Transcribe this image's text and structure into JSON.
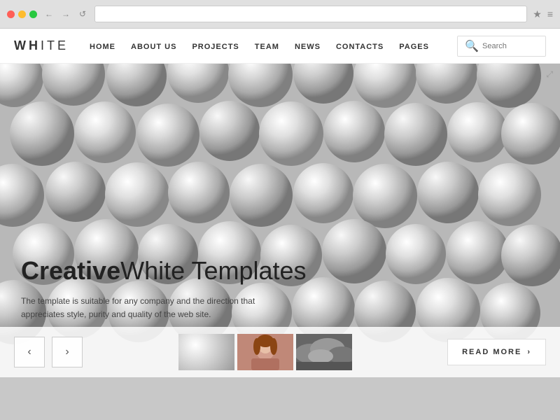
{
  "browser": {
    "dots": [
      "red",
      "yellow",
      "green"
    ],
    "back_label": "←",
    "forward_label": "→",
    "refresh_label": "↺",
    "address": "",
    "star_icon": "★",
    "menu_icon": "≡"
  },
  "site": {
    "logo": {
      "bold": "WH",
      "thin": "ITE"
    },
    "nav": {
      "items": [
        {
          "label": "HOME",
          "href": "#"
        },
        {
          "label": "ABOUT US",
          "href": "#"
        },
        {
          "label": "PROJECTS",
          "href": "#"
        },
        {
          "label": "TEAM",
          "href": "#"
        },
        {
          "label": "NEWS",
          "href": "#"
        },
        {
          "label": "CONTACTS",
          "href": "#"
        },
        {
          "label": "PAGES",
          "href": "#"
        }
      ]
    },
    "search": {
      "placeholder": "Search",
      "icon": "🔍"
    }
  },
  "hero": {
    "headline_bold": "Creative",
    "headline_thin": "White Templates",
    "subtext": "The template is suitable for any company and the direction\nthat appreciates style, purity and quality of the web site.",
    "prev_icon": "‹",
    "next_icon": "›",
    "read_more_label": "READ MORE",
    "read_more_arrow": "›",
    "thumbnails": [
      {
        "type": "balls",
        "alt": "balls thumbnail"
      },
      {
        "type": "woman",
        "alt": "woman thumbnail"
      },
      {
        "type": "clouds",
        "alt": "clouds thumbnail"
      }
    ]
  }
}
